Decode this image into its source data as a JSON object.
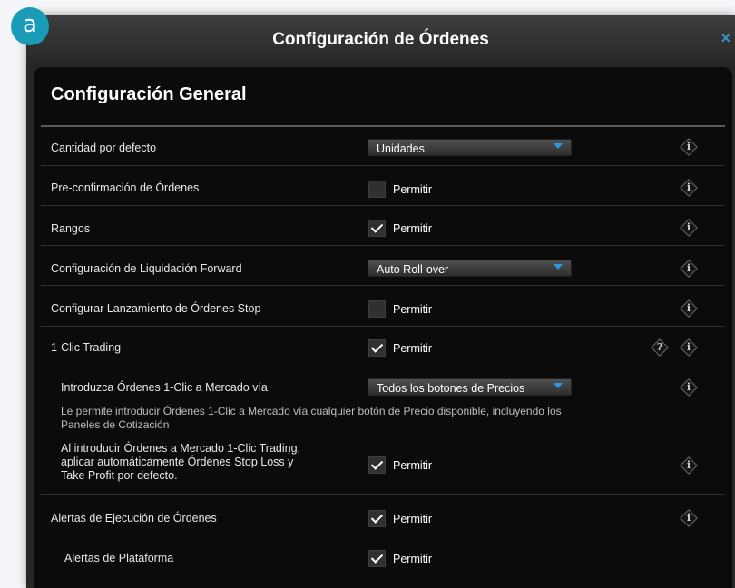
{
  "badge": "a",
  "window": {
    "title": "Configuración de Órdenes",
    "close_glyph": "×"
  },
  "section": {
    "title": "Configuración General"
  },
  "icons": {
    "info": "info-icon",
    "help": "help-icon",
    "check": "checkmark-icon",
    "dropdown_arrow": "chevron-down-icon"
  },
  "info_glyph": "i",
  "help_glyph": "?",
  "colors": {
    "accent": "#1a9bb8",
    "dropdown_arrow": "#2a9be0",
    "close": "#3d8fc8"
  },
  "rows": [
    {
      "label": "Cantidad por defecto",
      "control": "dropdown",
      "value": "Unidades"
    },
    {
      "label": "Pre-confirmación de Órdenes",
      "control": "checkbox",
      "checked": false,
      "option_label": "Permitir"
    },
    {
      "label": "Rangos",
      "control": "checkbox",
      "checked": true,
      "option_label": "Permitir"
    },
    {
      "label": "Configuración de Liquidación Forward",
      "control": "dropdown",
      "value": "Auto Roll-over"
    },
    {
      "label": "Configurar Lanzamiento de Órdenes Stop",
      "control": "checkbox",
      "checked": false,
      "option_label": "Permitir"
    },
    {
      "label": "1-Clic Trading",
      "control": "checkbox",
      "checked": true,
      "option_label": "Permitir"
    },
    {
      "label": "Introduzca Órdenes 1-Clic a Mercado vía",
      "control": "dropdown",
      "value": "Todos los botones de Precios",
      "description": [
        "Le permite introducir Órdenes 1-Clic a Mercado vía cualquier botón de Precio disponible, incluyendo los",
        "Paneles de Cotización"
      ]
    },
    {
      "label_lines": [
        "Al introducir Órdenes a Mercado 1-Clic Trading,",
        "aplicar automáticamente Órdenes Stop Loss y",
        "Take Profit por defecto."
      ],
      "control": "checkbox",
      "checked": true,
      "option_label": "Permitir"
    },
    {
      "label": "Alertas de Ejecución de Órdenes",
      "control": "checkbox",
      "checked": true,
      "option_label": "Permitir"
    },
    {
      "label": "Alertas de Plataforma",
      "control": "checkbox",
      "checked": true,
      "option_label": "Permitir"
    }
  ]
}
